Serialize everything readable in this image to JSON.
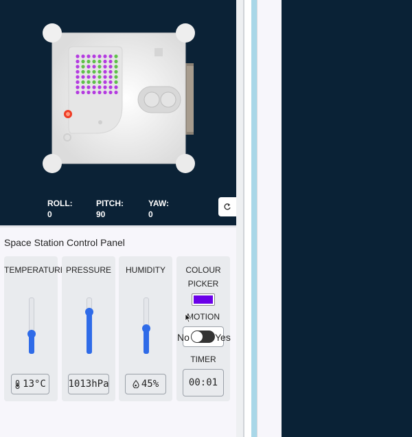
{
  "orientation": {
    "roll_label": "ROLL:",
    "roll_value": "0",
    "pitch_label": "PITCH:",
    "pitch_value": "90",
    "yaw_label": "YAW:",
    "yaw_value": "0",
    "reset_icon": "refresh-icon"
  },
  "panel": {
    "title": "Space Station Control Panel",
    "temperature": {
      "label": "TEMPERATURE",
      "value": "13°C",
      "level": 0.35,
      "icon": "thermometer-icon"
    },
    "pressure": {
      "label": "PRESSURE",
      "value": "1013hPa",
      "level": 0.75
    },
    "humidity": {
      "label": "HUMIDITY",
      "value": "45%",
      "level": 0.45,
      "icon": "droplet-icon"
    },
    "colour": {
      "label_line1": "COLOUR",
      "label_line2": "PICKER",
      "value": "#6a00e8"
    },
    "motion": {
      "label": "MOTION",
      "no_label": "No",
      "yes_label": "Yes",
      "enabled": false
    },
    "timer": {
      "label": "TIMER",
      "value": "00:01"
    }
  },
  "colors": {
    "background": "#0a2236",
    "accent": "#2f6be8",
    "led_green": "#5fc04a",
    "led_purple": "#b43ae0"
  }
}
